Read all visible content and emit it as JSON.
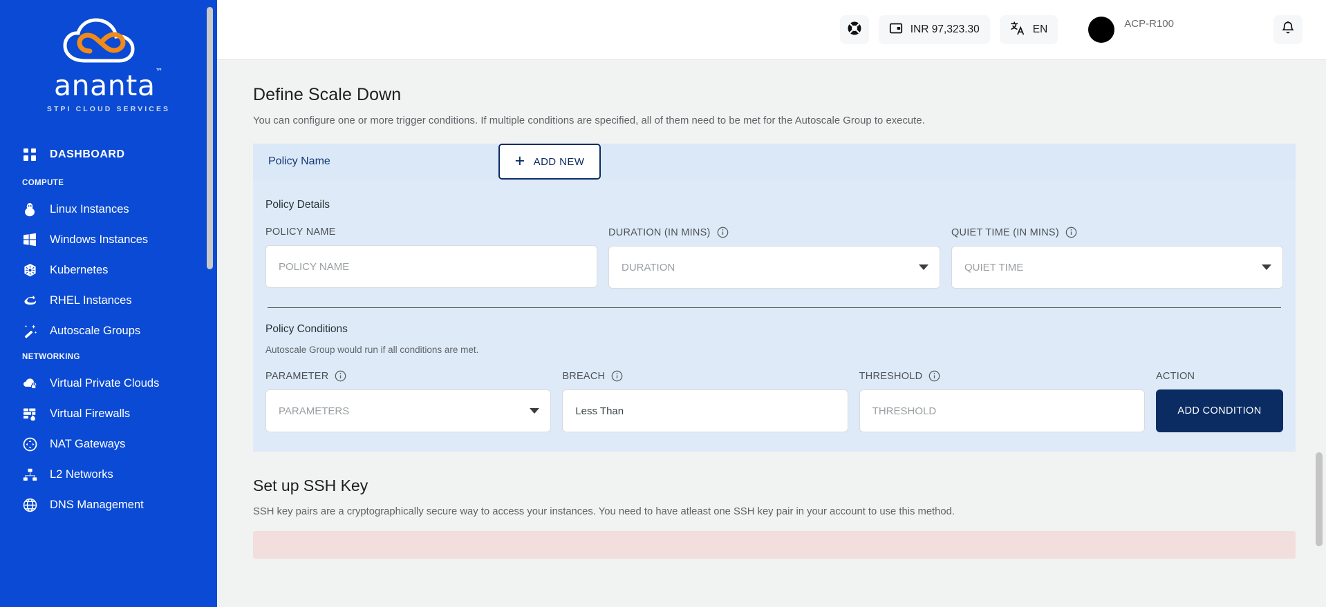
{
  "sidebar": {
    "logo": {
      "word": "ananta",
      "tm": "™",
      "subtitle": "STPI CLOUD SERVICES"
    },
    "dashboard": {
      "label": "DASHBOARD",
      "icon": "grid-icon"
    },
    "sections": [
      {
        "title": "COMPUTE",
        "items": [
          {
            "label": "Linux Instances",
            "icon": "linux-penguin-icon"
          },
          {
            "label": "Windows Instances",
            "icon": "windows-icon"
          },
          {
            "label": "Kubernetes",
            "icon": "kubernetes-icon"
          },
          {
            "label": "RHEL Instances",
            "icon": "redhat-icon"
          },
          {
            "label": "Autoscale Groups",
            "icon": "magic-wand-icon"
          }
        ]
      },
      {
        "title": "NETWORKING",
        "items": [
          {
            "label": "Virtual Private Clouds",
            "icon": "cloud-lock-icon"
          },
          {
            "label": "Virtual Firewalls",
            "icon": "firewall-icon"
          },
          {
            "label": "NAT Gateways",
            "icon": "nat-gateway-icon"
          },
          {
            "label": "L2 Networks",
            "icon": "network-tree-icon"
          },
          {
            "label": "DNS Management",
            "icon": "globe-icon"
          }
        ]
      }
    ]
  },
  "topbar": {
    "support_icon": "lifebuoy-icon",
    "wallet": {
      "icon": "wallet-icon",
      "amount": "INR 97,323.30"
    },
    "language": {
      "icon": "translate-icon",
      "code": "EN"
    },
    "user": {
      "name": "ACP-R100",
      "avatar": "avatar"
    },
    "notifications_icon": "bell-icon"
  },
  "main": {
    "title": "Define Scale Down",
    "description": "You can configure one or more trigger conditions. If multiple conditions are specified, all of them need to be met for the Autoscale Group to execute.",
    "tab_label": "Policy Name",
    "add_new_label": "ADD NEW",
    "policy_details": {
      "section_title": "Policy Details",
      "fields": [
        {
          "label": "POLICY NAME",
          "placeholder": "POLICY NAME",
          "value": "",
          "type": "text",
          "info": false
        },
        {
          "label": "DURATION (IN MINS)",
          "placeholder": "DURATION",
          "value": "",
          "type": "select",
          "info": true
        },
        {
          "label": "QUIET TIME (IN MINS)",
          "placeholder": "QUIET TIME",
          "value": "",
          "type": "select",
          "info": true
        }
      ]
    },
    "policy_conditions": {
      "section_title": "Policy Conditions",
      "section_sub": "Autoscale Group would run if all conditions are met.",
      "parameter": {
        "label": "PARAMETER",
        "placeholder": "PARAMETERS",
        "value": ""
      },
      "breach": {
        "label": "BREACH",
        "value": "Less Than"
      },
      "threshold": {
        "label": "THRESHOLD",
        "placeholder": "THRESHOLD",
        "value": ""
      },
      "action": {
        "label": "ACTION",
        "button_label": "ADD CONDITION"
      }
    },
    "ssh": {
      "title": "Set up SSH Key",
      "description": "SSH key pairs are a cryptographically secure way to access your instances. You need to have atleast one SSH key pair in your account to use this method."
    }
  },
  "colors": {
    "sidebar_blue": "#0A4AD4",
    "logo_orange": "#F08A18",
    "panel_blue": "#dfeaf8",
    "tab_blue": "#dbe8f7",
    "navy": "#0b2c63",
    "alert_pink": "#f2dedd"
  }
}
